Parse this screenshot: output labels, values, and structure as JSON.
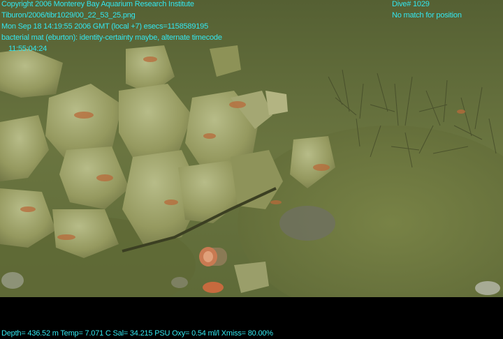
{
  "overlay": {
    "copyright": "Copyright 2006 Monterey Bay Aquarium Research Institute",
    "image_path": "Tiburon/2006/tibr1029/00_22_53_25.png",
    "datetime": "Mon Sep 18 14:19:55 2006 GMT (local +7)  esecs=1158589195",
    "annotation": "bacterial mat (eburton): identity-certainty maybe, alternate timecode",
    "timecode": "11:55:04:24",
    "dive": "Dive# 1029",
    "position_status": "No match for position",
    "telemetry": "Depth= 436.52 m  Temp= 7.071 C  Sal= 34.215 PSU  Oxy= 0.54 ml/l  Xmiss= 80.00%"
  },
  "colors": {
    "overlay_text": "#33e6ee",
    "water": "#6f7a44",
    "rock": "#9aa06a",
    "bacterial_mat": "#b86a3a"
  }
}
